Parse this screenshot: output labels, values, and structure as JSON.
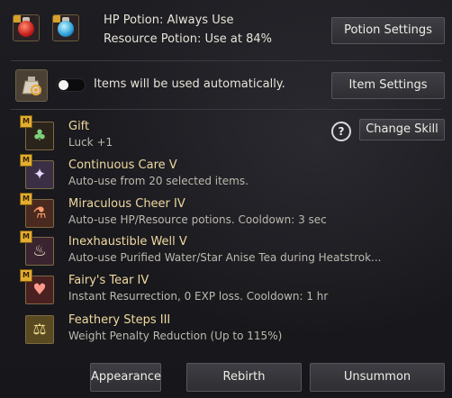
{
  "potions": {
    "hp_label": "HP Potion: Always Use",
    "resource_label": "Resource Potion: Use at 84%",
    "settings_button": "Potion Settings",
    "hp_icon": "red-potion-icon",
    "resource_icon": "blue-potion-icon"
  },
  "items": {
    "auto_label": "Items will be used automatically.",
    "toggle_on": false,
    "settings_button": "Item Settings",
    "icon": "item-bag-icon"
  },
  "skills": [
    {
      "name": "Gift",
      "desc": "Luck +1",
      "icon": "clover-icon",
      "badge": "M"
    },
    {
      "name": "Continuous Care V",
      "desc": "Auto-use from 20 selected items.",
      "icon": "fairy-icon",
      "badge": "M"
    },
    {
      "name": "Miraculous Cheer IV",
      "desc": "Auto-use HP/Resource potions. Cooldown: 3 sec",
      "icon": "potion-flask-icon",
      "badge": "M"
    },
    {
      "name": "Inexhaustible Well V",
      "desc": "Auto-use Purified Water/Star Anise Tea during Heatstrok...",
      "icon": "well-icon",
      "badge": "M"
    },
    {
      "name": "Fairy's Tear IV",
      "desc": "Instant Resurrection, 0 EXP loss. Cooldown: 1 hr",
      "icon": "tear-icon",
      "badge": "M"
    },
    {
      "name": "Feathery Steps III",
      "desc": "Weight Penalty Reduction (Up to 115%)",
      "icon": "weight-icon",
      "badge": ""
    }
  ],
  "change_skill_button": "Change Skill",
  "help_glyph": "?",
  "footer": {
    "appearance": "Appearance",
    "rebirth": "Rebirth",
    "unsummon": "Unsummon"
  }
}
